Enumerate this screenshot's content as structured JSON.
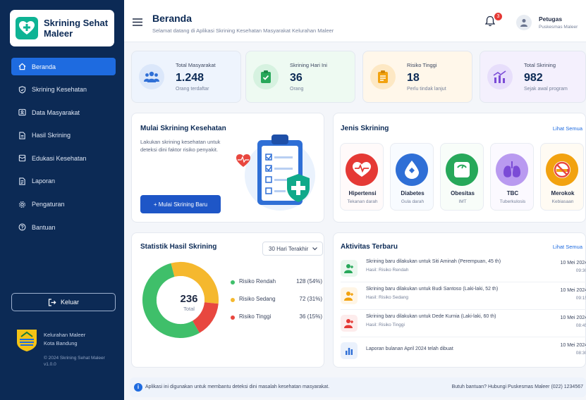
{
  "app": {
    "name_line1": "Skrining Sehat",
    "name_line2": "Maleer"
  },
  "sidebar": {
    "items": [
      {
        "label": "Beranda",
        "icon": "home-icon"
      },
      {
        "label": "Skrining Kesehatan",
        "icon": "shield-icon"
      },
      {
        "label": "Data Masyarakat",
        "icon": "users-icon"
      },
      {
        "label": "Hasil Skrining",
        "icon": "document-icon"
      },
      {
        "label": "Edukasi Kesehatan",
        "icon": "book-icon"
      },
      {
        "label": "Laporan",
        "icon": "report-icon"
      },
      {
        "label": "Pengaturan",
        "icon": "gear-icon"
      },
      {
        "label": "Bantuan",
        "icon": "help-icon"
      }
    ],
    "logout": "Keluar",
    "kelurahan_line1": "Kelurahan Maleer",
    "kelurahan_line2": "Kota Bandung",
    "copyright_line1": "© 2024 Skrining Sehat Maleer",
    "copyright_line2": "v1.0.0"
  },
  "header": {
    "title": "Beranda",
    "welcome": "Selamat datang di Aplikasi Skrining Kesehatan Masyarakat Kelurahan Maleer",
    "notif_count": "3",
    "user_name": "Petugas",
    "user_role": "Puskesmas Maleer"
  },
  "stats": [
    {
      "label": "Total Masyarakat",
      "value": "1.248",
      "sub": "Orang terdaftar",
      "color": "#2f6fd6",
      "bg": "#eef4fd"
    },
    {
      "label": "Skrining Hari Ini",
      "value": "36",
      "sub": "Orang",
      "color": "#27a85a",
      "bg": "#eefaf2"
    },
    {
      "label": "Risiko Tinggi",
      "value": "18",
      "sub": "Perlu tindak lanjut",
      "color": "#f2a20f",
      "bg": "#fff7ea"
    },
    {
      "label": "Total Skrining",
      "value": "982",
      "sub": "Sejak awal program",
      "color": "#7b4bd6",
      "bg": "#f4f0fd"
    }
  ],
  "start": {
    "title": "Mulai Skrining Kesehatan",
    "desc": "Lakukan skrining kesehatan untuk deteksi dini faktor risiko penyakit.",
    "button": "+ Mulai Skrining Baru"
  },
  "jenis": {
    "title": "Jenis Skrining",
    "link": "Lihat Semua",
    "items": [
      {
        "name": "Hipertensi",
        "sub": "Tekanan darah",
        "color": "#e53935",
        "bg": "#fdecec",
        "icon": "heart-pulse-icon"
      },
      {
        "name": "Diabetes",
        "sub": "Gula darah",
        "color": "#2f6fd6",
        "bg": "#eaf1fc",
        "icon": "blood-drop-icon"
      },
      {
        "name": "Obesitas",
        "sub": "IMT",
        "color": "#27a85a",
        "bg": "#e9f7ee",
        "icon": "scale-icon"
      },
      {
        "name": "TBC",
        "sub": "Tuberkulosis",
        "color": "#8f63d9",
        "bg": "#f2ecfc",
        "icon": "lungs-icon"
      },
      {
        "name": "Merokok",
        "sub": "Kebiasaan",
        "color": "#f2a20f",
        "bg": "#fff5e5",
        "icon": "no-smoking-icon"
      }
    ]
  },
  "stat_chart": {
    "title": "Statistik Hasil Skrining",
    "period": "30 Hari Terakhir",
    "total": "236",
    "total_label": "Total"
  },
  "chart_data": {
    "type": "pie",
    "labels": [
      "Risiko Rendah",
      "Risiko Sedang",
      "Risiko Tinggi"
    ],
    "values": [
      128,
      72,
      36
    ],
    "percent_labels": [
      "128 (54%)",
      "72 (31%)",
      "36 (15%)"
    ],
    "colors": [
      "#3fbf6a",
      "#f5b82e",
      "#e8473f"
    ],
    "title": "Statistik Hasil Skrining"
  },
  "activity": {
    "title": "Aktivitas Terbaru",
    "link": "Lihat Semua",
    "items": [
      {
        "text": "Skrining baru dilakukan untuk Siti Aminah (Perempuan, 45 th)",
        "status": "Hasil: Risiko Rendah",
        "date": "10 Mei 2024",
        "time": "09:30",
        "color": "#27a85a",
        "bg": "#e9f7ee",
        "icon": "user-icon"
      },
      {
        "text": "Skrining baru dilakukan untuk Budi Santoso (Laki-laki, 52 th)",
        "status": "Hasil: Risiko Sedang",
        "date": "10 Mei 2024",
        "time": "09:15",
        "color": "#f2a20f",
        "bg": "#fff5e5",
        "icon": "user-icon"
      },
      {
        "text": "Skrining baru dilakukan untuk Dede Kurnia (Laki-laki, 60 th)",
        "status": "Hasil: Risiko Tinggi",
        "date": "10 Mei 2024",
        "time": "08:45",
        "color": "#e53935",
        "bg": "#fdecec",
        "icon": "user-icon"
      },
      {
        "text": "Laporan bulanan April 2024 telah dibuat",
        "status": "",
        "date": "10 Mei 2024",
        "time": "08:30",
        "color": "#2f6fd6",
        "bg": "#eaf1fc",
        "icon": "chart-icon"
      }
    ]
  },
  "footer": {
    "info": "Aplikasi ini digunakan untuk membantu deteksi dini masalah kesehatan masyarakat.",
    "help": "Butuh bantuan? Hubungi Puskesmas Maleer (022) 1234567"
  }
}
